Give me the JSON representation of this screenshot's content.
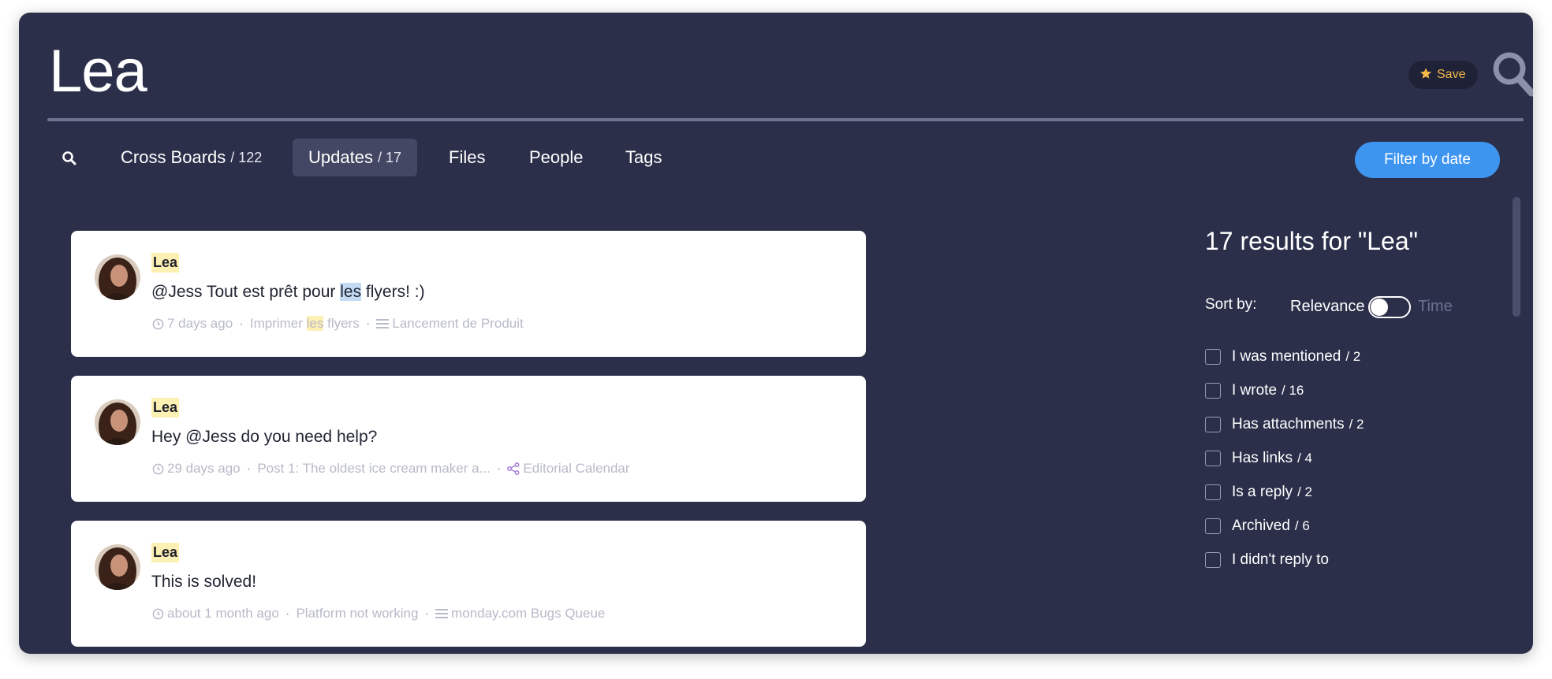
{
  "header": {
    "title": "Lea",
    "save_label": "Save",
    "save_icon": "star-icon",
    "search_icon": "search-icon"
  },
  "tabs": [
    {
      "label": "Cross Boards",
      "count": "/ 122",
      "active": false
    },
    {
      "label": "Updates",
      "count": "/ 17",
      "active": true
    },
    {
      "label": "Files",
      "count": "",
      "active": false
    },
    {
      "label": "People",
      "count": "",
      "active": false
    },
    {
      "label": "Tags",
      "count": "",
      "active": false
    }
  ],
  "filter_by_date_label": "Filter by date",
  "updates": [
    {
      "author": "Lea",
      "body_before": "@Jess Tout est prêt pour ",
      "body_highlight": "les",
      "body_after": " flyers! :)",
      "time": "7 days ago",
      "item_before": "Imprimer ",
      "item_highlight": "les",
      "item_after": " flyers",
      "board": "Lancement de Produit",
      "board_icon": "board-lines-icon"
    },
    {
      "author": "Lea",
      "body_before": "Hey @Jess do you need help?",
      "body_highlight": "",
      "body_after": "",
      "time": "29 days ago",
      "item_before": "Post 1: The oldest ice cream maker a...",
      "item_highlight": "",
      "item_after": "",
      "board": "Editorial Calendar",
      "board_icon": "share-icon"
    },
    {
      "author": "Lea",
      "body_before": "This is solved!",
      "body_highlight": "",
      "body_after": "",
      "time": "about 1 month ago",
      "item_before": "Platform not working",
      "item_highlight": "",
      "item_after": "",
      "board": "monday.com Bugs Queue",
      "board_icon": "board-lines-icon"
    }
  ],
  "sidebar": {
    "results_text": "17 results for \"Lea\"",
    "sort_label": "Sort by:",
    "sort_relevance": "Relevance",
    "sort_time": "Time",
    "filters": [
      {
        "label": "I was mentioned",
        "count": "/ 2"
      },
      {
        "label": "I wrote",
        "count": "/ 16"
      },
      {
        "label": "Has attachments",
        "count": "/ 2"
      },
      {
        "label": "Has links",
        "count": "/ 4"
      },
      {
        "label": "Is a reply",
        "count": "/ 2"
      },
      {
        "label": "Archived",
        "count": "/ 6"
      },
      {
        "label": "I didn't reply to",
        "count": ""
      }
    ]
  },
  "colors": {
    "background": "#2b2f4a",
    "accent": "#3e95f0",
    "highlight": "#fdf0b3",
    "save": "#f5b94a"
  }
}
